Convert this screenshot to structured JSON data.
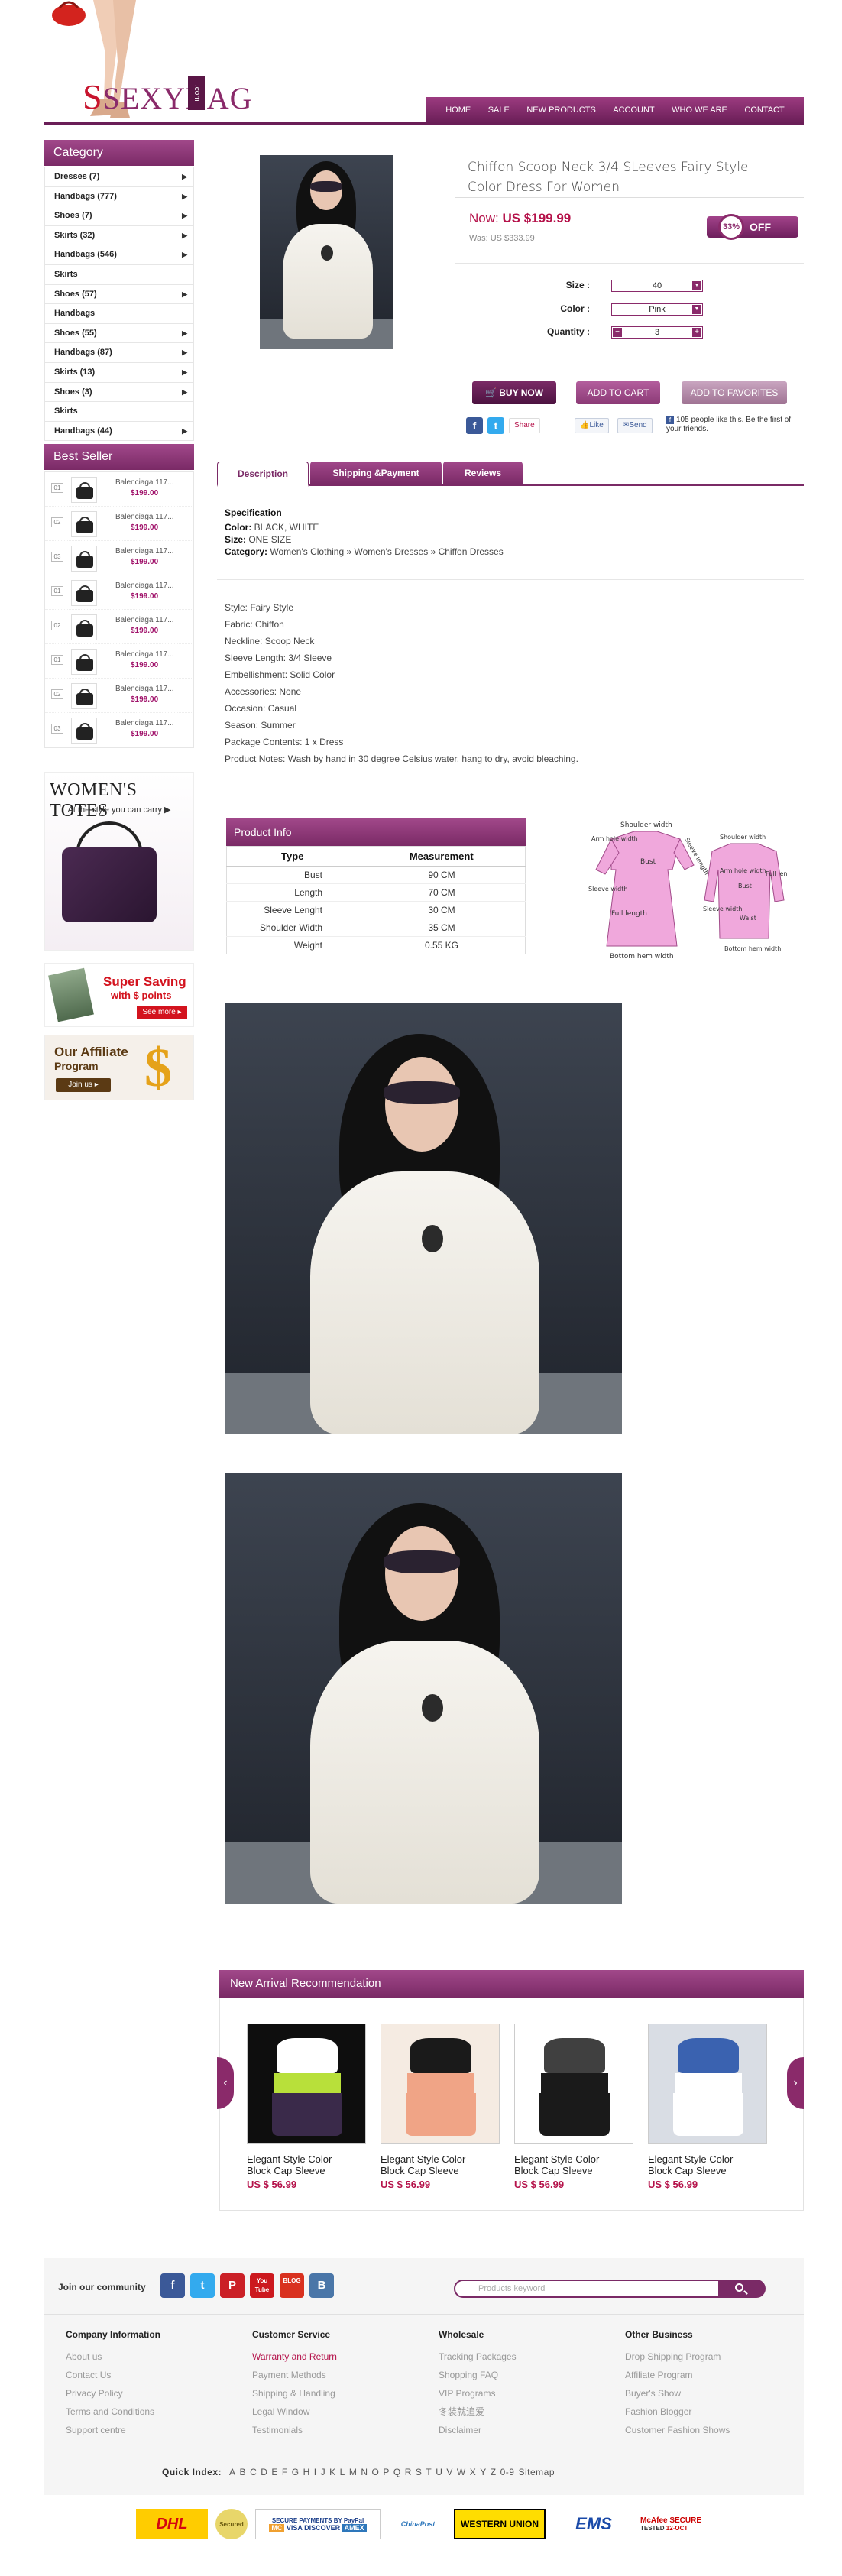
{
  "header": {
    "logo_text": "SEXYBAG",
    "logo_suffix": ".com",
    "nav": [
      "HOME",
      "SALE",
      "NEW PRODUCTS",
      "ACCOUNT",
      "WHO WE ARE",
      "CONTACT"
    ]
  },
  "sidebar": {
    "category_title": "Category",
    "categories": [
      {
        "label": "Dresses (7)",
        "arrow": true
      },
      {
        "label": "Handbags (777)",
        "arrow": true
      },
      {
        "label": "Shoes (7)",
        "arrow": true
      },
      {
        "label": "Skirts (32)",
        "arrow": true
      },
      {
        "label": "Handbags (546)",
        "arrow": true
      },
      {
        "label": "Skirts",
        "arrow": false
      },
      {
        "label": "Shoes (57)",
        "arrow": true
      },
      {
        "label": "Handbags",
        "arrow": false
      },
      {
        "label": "Shoes (55)",
        "arrow": true
      },
      {
        "label": "Handbags (87)",
        "arrow": true
      },
      {
        "label": "Skirts (13)",
        "arrow": true
      },
      {
        "label": "Shoes (3)",
        "arrow": true
      },
      {
        "label": "Skirts",
        "arrow": false
      },
      {
        "label": "Handbags (44)",
        "arrow": true
      }
    ],
    "bestseller_title": "Best Seller",
    "bestsellers": [
      {
        "num": "01",
        "name": "Balenciaga 117...",
        "price": "$199.00"
      },
      {
        "num": "02",
        "name": "Balenciaga 117...",
        "price": "$199.00"
      },
      {
        "num": "03",
        "name": "Balenciaga 117...",
        "price": "$199.00"
      },
      {
        "num": "01",
        "name": "Balenciaga 117...",
        "price": "$199.00"
      },
      {
        "num": "02",
        "name": "Balenciaga 117...",
        "price": "$199.00"
      },
      {
        "num": "01",
        "name": "Balenciaga 117...",
        "price": "$199.00"
      },
      {
        "num": "02",
        "name": "Balenciaga 117...",
        "price": "$199.00"
      },
      {
        "num": "03",
        "name": "Balenciaga 117...",
        "price": "$199.00"
      }
    ],
    "promo_totes": {
      "title": "WOMEN'S TOTES",
      "subtitle": "At the style you can carry ▶"
    },
    "promo_saving": {
      "line1": "Super Saving",
      "line2": "with $ points",
      "button": "See more ▸"
    },
    "promo_affiliate": {
      "line1": "Our Affiliate",
      "line2": "Program",
      "button": "Join us ▸",
      "symbol": "$"
    }
  },
  "product": {
    "title": "Chiffon Scoop Neck 3/4 SLeeves Fairy Style Color Dress For Women",
    "price_now_label": "Now:",
    "price_now": "US $199.99",
    "price_was": "Was: US  $333.99",
    "discount_percent": "33%",
    "discount_label": "OFF",
    "size_label": "Size :",
    "size_value": "40",
    "color_label": "Color :",
    "color_value": "Pink",
    "quantity_label": "Quantity :",
    "quantity_value": "3",
    "buy_now": "BUY NOW",
    "add_to_cart": "ADD TO CART",
    "add_to_favorites": "ADD TO FAVORITES",
    "share_label": "Share",
    "like_label": "Like",
    "send_label": "Send",
    "fb_like_text": "105 people like this. Be the first of your friends."
  },
  "tabs": [
    "Description",
    "Shipping &Payment",
    "Reviews"
  ],
  "specification": {
    "heading": "Specification",
    "color_key": "Color:",
    "color_val": " BLACK, WHITE",
    "size_key": "Size:",
    "size_val": " ONE SIZE",
    "category_key": "Category:",
    "category_val": " Women's Clothing » Women's Dresses » Chiffon Dresses"
  },
  "details": [
    "Style: Fairy Style",
    "Fabric: Chiffon",
    "Neckline: Scoop Neck",
    "Sleeve Length: 3/4 Sleeve",
    "Embellishment: Solid Color",
    "Accessories: None",
    "Occasion: Casual",
    "Season: Summer",
    "Package Contents: 1 x Dress",
    "Product Notes: Wash by hand in 30 degree Celsius water, hang to dry, avoid bleaching."
  ],
  "product_info": {
    "title": "Product Info",
    "col_type": "Type",
    "col_measure": "Measurement",
    "rows": [
      {
        "type": "Bust",
        "value": "90 CM"
      },
      {
        "type": "Length",
        "value": "70 CM"
      },
      {
        "type": "Sleeve Lenght",
        "value": "30 CM"
      },
      {
        "type": "Shoulder Width",
        "value": "35 CM"
      },
      {
        "type": "Weight",
        "value": "0.55 KG"
      }
    ]
  },
  "diagram_labels": {
    "shoulder_width": "Shoulder width",
    "arm_hole_width": "Arm hole width",
    "sleeve_length": "Sleeve length",
    "bust": "Bust",
    "sleeve_width": "Sleeve width",
    "full_length": "Full length",
    "bottom_hem_width": "Bottom hem width",
    "waist": "Waist"
  },
  "recommendation": {
    "title": "New Arrival Recommendation",
    "items": [
      {
        "name": "Elegant Style Color Block Cap Sleeve",
        "price": "US $ 56.99"
      },
      {
        "name": "Elegant Style Color Block Cap Sleeve",
        "price": "US $ 56.99"
      },
      {
        "name": "Elegant Style Color Block Cap Sleeve",
        "price": "US $ 56.99"
      },
      {
        "name": "Elegant Style Color Block Cap Sleeve",
        "price": "US $ 56.99"
      }
    ]
  },
  "footer": {
    "join_label": "Join our community",
    "social": [
      {
        "icon": "facebook-icon",
        "glyph": "f",
        "color": "#3b5998"
      },
      {
        "icon": "twitter-icon",
        "glyph": "t",
        "color": "#33aaee"
      },
      {
        "icon": "pinterest-icon",
        "glyph": "P",
        "color": "#cb2027"
      },
      {
        "icon": "youtube-icon",
        "glyph": "You Tube",
        "color": "#cc181e"
      },
      {
        "icon": "blog-icon",
        "glyph": "BLOG",
        "color": "#d9311f"
      },
      {
        "icon": "vk-icon",
        "glyph": "B",
        "color": "#4a76a8"
      }
    ],
    "search_placeholder": "Products keyword",
    "columns": [
      {
        "title": "Company Information",
        "links": [
          "About us",
          "Contact Us",
          "Privacy Policy",
          "Terms and Conditions",
          "Support centre"
        ]
      },
      {
        "title": "Customer Service",
        "links": [
          "Warranty and Return",
          "Payment Methods",
          "Shipping & Handling",
          "Legal Window",
          "Testimonials"
        ]
      },
      {
        "title": "Wholesale",
        "links": [
          "Tracking Packages",
          "Shopping FAQ",
          "VIP Programs",
          "冬装就追爱",
          "Disclaimer"
        ]
      },
      {
        "title": "Other Business",
        "links": [
          "Drop Shipping Program",
          "Affiliate Program",
          "Buyer's Show",
          "Fashion Blogger",
          "Customer Fashion Shows"
        ]
      }
    ],
    "quick_index_label": "Quick Index:",
    "quick_index": [
      "A",
      "B",
      "C",
      "D",
      "E",
      "F",
      "G",
      "H",
      "I",
      "J",
      "K",
      "L",
      "M",
      "N",
      "O",
      "P",
      "Q",
      "R",
      "S",
      "T",
      "U",
      "V",
      "W",
      "X",
      "Y",
      "Z",
      "0-9",
      "Sitemap"
    ],
    "payment": [
      "DHL",
      "Secured",
      "SECURE PAYMENTS BY PayPal",
      "VISA",
      "DISCOVER",
      "ChinaPost",
      "WESTERN UNION",
      "EMS",
      "McAfee SECURE",
      "TESTED",
      "12-OCT"
    ]
  },
  "colors": {
    "brand": "#7a2a66",
    "accent": "#b5124a"
  }
}
